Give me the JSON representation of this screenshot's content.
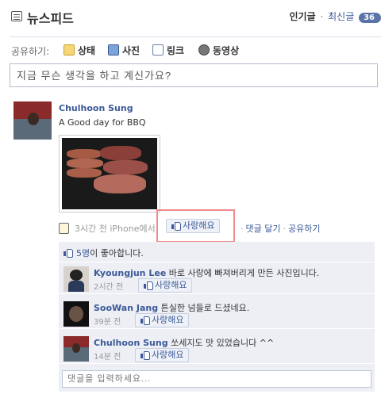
{
  "header": {
    "title": "뉴스피드",
    "top_stories": "인기글",
    "separator": "·",
    "most_recent": "최신글",
    "badge": "36"
  },
  "share": {
    "label": "공유하기:",
    "status": "상태",
    "photo": "사진",
    "link": "링크",
    "video": "동영상",
    "placeholder": "지금 무슨 생각을 하고 계신가요?"
  },
  "story": {
    "author": "Chulhoon Sung",
    "message": "A Good day for BBQ",
    "time": "3시간 전 iPhone에서",
    "like_label": "사랑해요",
    "comment_label": "댓글 달기",
    "share_label": "공유하기",
    "likes_count": "5명",
    "likes_suffix": "이 좋아합니다."
  },
  "comments": [
    {
      "author": "Kyoungjun Lee",
      "text": "바로 사랑에 빠져버리게 만든 사진입니다.",
      "time": "2시간 전",
      "like_label": "사랑해요"
    },
    {
      "author": "SooWan Jang",
      "text": "튼실한 넘들로 드셨네요.",
      "time": "39분 전",
      "like_label": "사랑해요"
    },
    {
      "author": "Chulhoon Sung",
      "text": "쏘세지도 맛 있었습니다 ^^",
      "time": "14분 전",
      "like_label": "사랑해요"
    }
  ],
  "reply": {
    "placeholder": "댓글을 입력하세요..."
  },
  "icons": [
    "news-feed-icon",
    "status-icon",
    "photo-icon",
    "link-icon",
    "video-icon",
    "iphone-app-icon",
    "like-thumb-icon"
  ],
  "colors": {
    "link": "#3b5998",
    "feedback_bg": "#edeff4",
    "highlight": "#f08a8a",
    "badge": "#5b74a8"
  }
}
